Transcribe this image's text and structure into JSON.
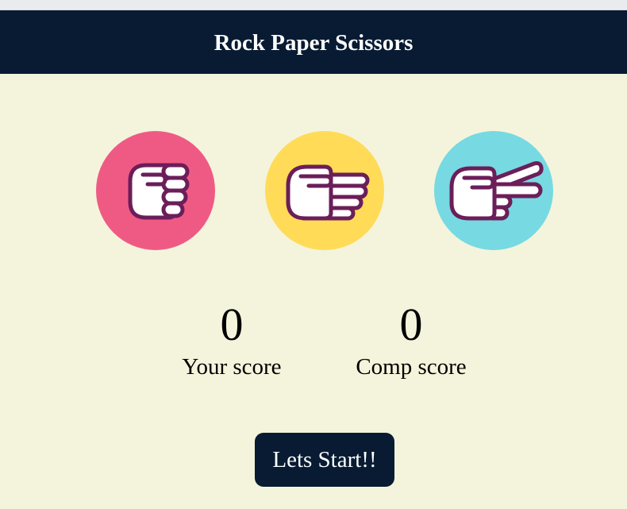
{
  "header": {
    "title": "Rock Paper Scissors"
  },
  "choices": [
    {
      "id": "rock",
      "icon": "rock-hand-icon",
      "color": "#ef5a84"
    },
    {
      "id": "paper",
      "icon": "paper-hand-icon",
      "color": "#ffdb58"
    },
    {
      "id": "scissors",
      "icon": "scissors-hand-icon",
      "color": "#77d9e2"
    }
  ],
  "scores": {
    "user": {
      "value": "0",
      "label": "Your score"
    },
    "comp": {
      "value": "0",
      "label": "Comp score"
    }
  },
  "start_button": {
    "label": "Lets Start!!"
  },
  "colors": {
    "background": "#f4f4dc",
    "header_bg": "#081b33",
    "header_text": "#ffffff",
    "hand_outline": "#6b1e59",
    "hand_fill": "#ffffff"
  }
}
